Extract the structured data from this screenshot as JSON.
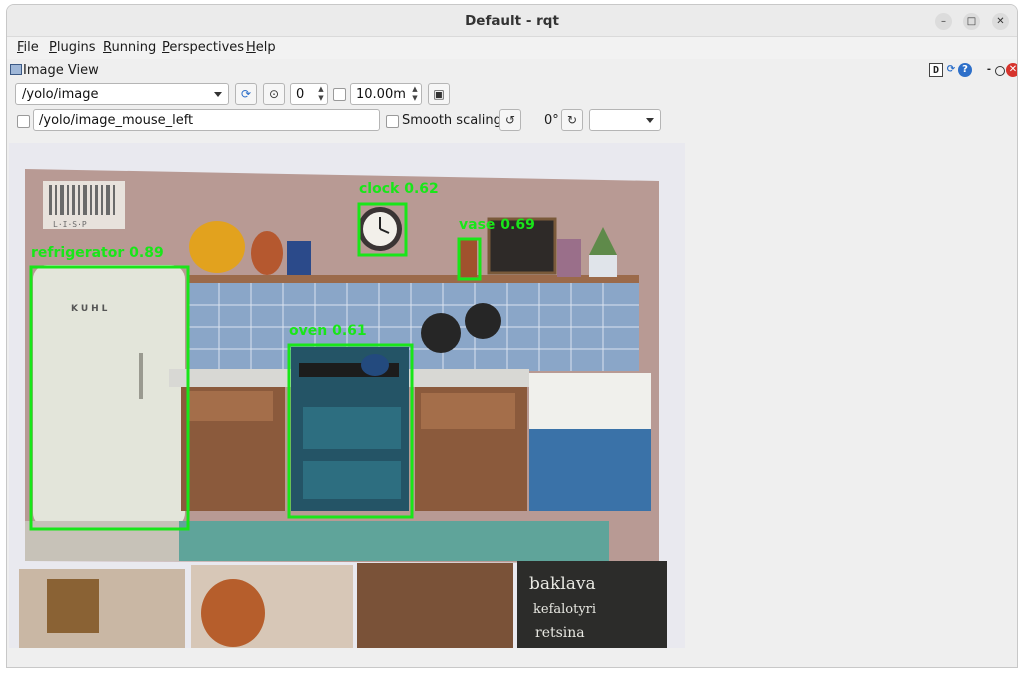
{
  "window": {
    "title": "Default - rqt"
  },
  "menu": [
    {
      "label": "File",
      "accel": "F",
      "rest": "ile"
    },
    {
      "label": "Plugins",
      "accel": "P",
      "rest": "lugins"
    },
    {
      "label": "Running",
      "accel": "R",
      "rest": "unning"
    },
    {
      "label": "Perspectives",
      "accel": "P",
      "rest": "erspectives"
    },
    {
      "label": "Help",
      "accel": "H",
      "rest": "elp"
    }
  ],
  "dock": {
    "title": "Image View",
    "icons": [
      "window-icon",
      "d-toggle-icon",
      "reload-icon",
      "help-icon",
      "minimize-dash-icon",
      "float-icon",
      "close-icon"
    ],
    "d_label": "D",
    "dash_label": "-",
    "o_label": "O"
  },
  "toolbar": {
    "topic": "/yolo/image",
    "zoom_value": "0",
    "duration_value": "10.00m",
    "mouse_topic": "/yolo/image_mouse_left",
    "smooth_label": "Smooth scaling",
    "rotation": "0°",
    "rotation_select": ""
  },
  "detections": [
    {
      "label": "refrigerator 0.89"
    },
    {
      "label": "clock 0.62"
    },
    {
      "label": "vase 0.69"
    },
    {
      "label": "oven 0.61"
    }
  ],
  "photo_texts": {
    "sign_line1": "baklava",
    "sign_line2": "kefalotyri",
    "sign_line3": "retsina",
    "fridge_brand": "KUHL",
    "shop_sign": "L·I·S·P"
  },
  "colors": {
    "accent": "#2d6fc9",
    "bbox": "#19e619",
    "close": "#d6332c"
  }
}
